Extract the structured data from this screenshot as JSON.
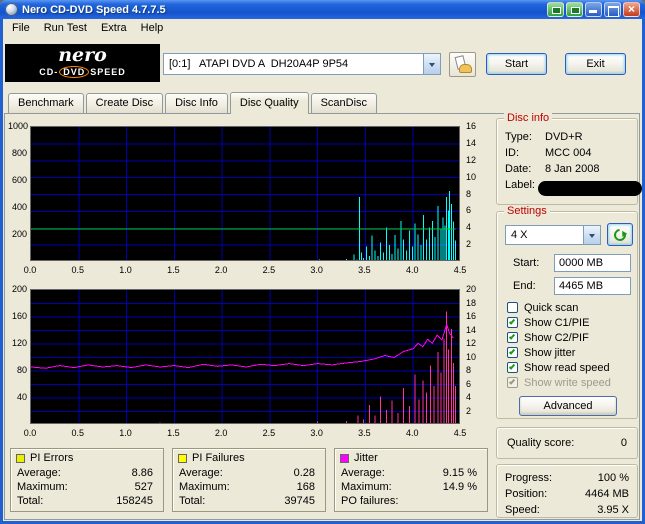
{
  "window": {
    "title": "Nero CD-DVD Speed 4.7.7.5"
  },
  "menu": {
    "items": [
      {
        "label": "File"
      },
      {
        "label": "Run Test"
      },
      {
        "label": "Extra"
      },
      {
        "label": "Help"
      }
    ]
  },
  "logo": {
    "script": "nero",
    "sub_prefix": "CD-",
    "sub_oval": "DVD",
    "sub_suffix": "SPEED"
  },
  "toolbar": {
    "drive": "[0:1]   ATAPI DVD A  DH20A4P 9P54",
    "start_label": "Start",
    "exit_label": "Exit"
  },
  "tabs": {
    "active": "Disc Quality",
    "items": [
      {
        "label": "Benchmark"
      },
      {
        "label": "Create Disc"
      },
      {
        "label": "Disc Info"
      },
      {
        "label": "Disc Quality"
      },
      {
        "label": "ScanDisc"
      }
    ]
  },
  "disc_info": {
    "title": "Disc info",
    "rows": [
      {
        "label": "Type:",
        "value": "DVD+R"
      },
      {
        "label": "ID:",
        "value": "MCC 004"
      },
      {
        "label": "Date:",
        "value": "8 Jan 2008"
      },
      {
        "label": "Label:",
        "value": ""
      }
    ]
  },
  "settings": {
    "title": "Settings",
    "speed_value": "4 X",
    "start": {
      "label": "Start:",
      "value": "0000 MB"
    },
    "end": {
      "label": "End:",
      "value": "4465 MB"
    },
    "checkboxes": [
      {
        "label": "Quick scan",
        "checked": false,
        "disabled": false
      },
      {
        "label": "Show C1/PIE",
        "checked": true,
        "disabled": false
      },
      {
        "label": "Show C2/PIF",
        "checked": true,
        "disabled": false
      },
      {
        "label": "Show jitter",
        "checked": true,
        "disabled": false
      },
      {
        "label": "Show read speed",
        "checked": true,
        "disabled": false
      },
      {
        "label": "Show write speed",
        "checked": true,
        "disabled": true
      }
    ],
    "advanced_label": "Advanced"
  },
  "quality": {
    "label": "Quality score:",
    "value": "0"
  },
  "progress": {
    "rows": [
      {
        "label": "Progress:",
        "value": "100 %"
      },
      {
        "label": "Position:",
        "value": "4464 MB"
      },
      {
        "label": "Speed:",
        "value": "3.95 X"
      }
    ]
  },
  "stats": [
    {
      "title": "PI Errors",
      "color": "#e8f000",
      "rows": [
        {
          "label": "Average:",
          "value": "8.86"
        },
        {
          "label": "Maximum:",
          "value": "527"
        },
        {
          "label": "Total:",
          "value": "158245"
        }
      ]
    },
    {
      "title": "PI Failures",
      "color": "#ffff00",
      "rows": [
        {
          "label": "Average:",
          "value": "0.28"
        },
        {
          "label": "Maximum:",
          "value": "168"
        },
        {
          "label": "Total:",
          "value": "39745"
        }
      ]
    },
    {
      "title": "Jitter",
      "color": "#ff00ff",
      "rows": [
        {
          "label": "Average:",
          "value": "9.15 %"
        },
        {
          "label": "Maximum:",
          "value": "14.9 %"
        },
        {
          "label": "PO failures:",
          "value": ""
        }
      ]
    }
  ],
  "chart_data": [
    {
      "type": "line",
      "title": "PIE errors and read speed vs disc position (GB)",
      "x_min": 0,
      "x_max": 4.5,
      "x_tick_step": 0.5,
      "x_tick_labels": [
        "0.0",
        "0.5",
        "1.0",
        "1.5",
        "2.0",
        "2.5",
        "3.0",
        "3.5",
        "4.0",
        "4.5"
      ],
      "left_axis": {
        "max": 1000,
        "ticks": [
          1000,
          800,
          600,
          400,
          200
        ]
      },
      "right_axis": {
        "max": 16,
        "ticks": [
          16,
          14,
          12,
          10,
          8,
          6,
          4,
          2
        ]
      },
      "bg": "#000000",
      "grid_color": "#0000b0",
      "legend": "off",
      "series": [
        {
          "name": "C1/PIE errors",
          "style": "spikes",
          "axis": "left",
          "color": "#00ffff",
          "points": [
            [
              0.03,
              2
            ],
            [
              0.1,
              3
            ],
            [
              0.18,
              2
            ],
            [
              0.26,
              4
            ],
            [
              0.34,
              2
            ],
            [
              0.42,
              3
            ],
            [
              0.5,
              6
            ],
            [
              0.55,
              14
            ],
            [
              0.62,
              3
            ],
            [
              0.7,
              2
            ],
            [
              0.78,
              4
            ],
            [
              0.86,
              2
            ],
            [
              0.94,
              3
            ],
            [
              1.02,
              10
            ],
            [
              1.1,
              3
            ],
            [
              1.18,
              2
            ],
            [
              1.26,
              4
            ],
            [
              1.34,
              2
            ],
            [
              1.42,
              5
            ],
            [
              1.5,
              3
            ],
            [
              1.58,
              2
            ],
            [
              1.66,
              4
            ],
            [
              1.74,
              2
            ],
            [
              1.82,
              3
            ],
            [
              1.9,
              2
            ],
            [
              1.98,
              5
            ],
            [
              2.06,
              3
            ],
            [
              2.14,
              2
            ],
            [
              2.22,
              4
            ],
            [
              2.3,
              14
            ],
            [
              2.38,
              3
            ],
            [
              2.46,
              2
            ],
            [
              2.54,
              5
            ],
            [
              2.62,
              3
            ],
            [
              2.7,
              2
            ],
            [
              2.78,
              4
            ],
            [
              2.86,
              3
            ],
            [
              2.94,
              2
            ],
            [
              3.02,
              18
            ],
            [
              3.08,
              6
            ],
            [
              3.14,
              4
            ],
            [
              3.2,
              10
            ],
            [
              3.26,
              8
            ],
            [
              3.3,
              24
            ],
            [
              3.34,
              12
            ],
            [
              3.38,
              55
            ],
            [
              3.41,
              20
            ],
            [
              3.44,
              480
            ],
            [
              3.46,
              70
            ],
            [
              3.48,
              30
            ],
            [
              3.51,
              115
            ],
            [
              3.54,
              45
            ],
            [
              3.57,
              195
            ],
            [
              3.6,
              85
            ],
            [
              3.63,
              45
            ],
            [
              3.66,
              145
            ],
            [
              3.69,
              70
            ],
            [
              3.72,
              255
            ],
            [
              3.75,
              125
            ],
            [
              3.78,
              60
            ],
            [
              3.81,
              200
            ],
            [
              3.84,
              100
            ],
            [
              3.87,
              305
            ],
            [
              3.9,
              165
            ],
            [
              3.93,
              85
            ],
            [
              3.96,
              235
            ],
            [
              3.99,
              115
            ],
            [
              4.02,
              285
            ],
            [
              4.05,
              205
            ],
            [
              4.08,
              125
            ],
            [
              4.11,
              350
            ],
            [
              4.14,
              165
            ],
            [
              4.17,
              255
            ],
            [
              4.2,
              305
            ],
            [
              4.23,
              185
            ],
            [
              4.26,
              415
            ],
            [
              4.29,
              240
            ],
            [
              4.31,
              330
            ],
            [
              4.33,
              270
            ],
            [
              4.35,
              480
            ],
            [
              4.37,
              380
            ],
            [
              4.38,
              527
            ],
            [
              4.4,
              430
            ],
            [
              4.42,
              300
            ],
            [
              4.44,
              160
            ]
          ]
        },
        {
          "name": "Read speed (X)",
          "style": "line",
          "axis": "right",
          "color": "#00cc00",
          "points": [
            [
              0,
              3.9
            ],
            [
              4.44,
              3.9
            ]
          ]
        }
      ]
    },
    {
      "type": "line",
      "title": "PIF errors and jitter vs disc position (GB)",
      "x_min": 0,
      "x_max": 4.5,
      "x_tick_step": 0.5,
      "x_tick_labels": [
        "0.0",
        "0.5",
        "1.0",
        "1.5",
        "2.0",
        "2.5",
        "3.0",
        "3.5",
        "4.0",
        "4.5"
      ],
      "left_axis": {
        "max": 200,
        "ticks": [
          200,
          160,
          120,
          80,
          40
        ]
      },
      "right_axis": {
        "max": 20,
        "ticks": [
          20,
          18,
          16,
          14,
          12,
          10,
          8,
          6,
          4,
          2
        ]
      },
      "bg": "#000000",
      "grid_color": "#0000b0",
      "legend": "off",
      "series": [
        {
          "name": "C2/PIF errors",
          "style": "spikes",
          "axis": "left",
          "color": "#ff3399",
          "points": [
            [
              0.45,
              2
            ],
            [
              0.9,
              3
            ],
            [
              1.35,
              4
            ],
            [
              1.8,
              2
            ],
            [
              2.25,
              3
            ],
            [
              2.7,
              2
            ],
            [
              3.0,
              5
            ],
            [
              3.15,
              3
            ],
            [
              3.3,
              6
            ],
            [
              3.42,
              14
            ],
            [
              3.48,
              8
            ],
            [
              3.54,
              30
            ],
            [
              3.6,
              14
            ],
            [
              3.66,
              42
            ],
            [
              3.72,
              22
            ],
            [
              3.78,
              36
            ],
            [
              3.84,
              18
            ],
            [
              3.9,
              55
            ],
            [
              3.96,
              28
            ],
            [
              4.02,
              75
            ],
            [
              4.06,
              38
            ],
            [
              4.1,
              66
            ],
            [
              4.14,
              48
            ],
            [
              4.18,
              88
            ],
            [
              4.22,
              58
            ],
            [
              4.26,
              108
            ],
            [
              4.29,
              78
            ],
            [
              4.32,
              128
            ],
            [
              4.35,
              168
            ],
            [
              4.37,
              112
            ],
            [
              4.4,
              142
            ],
            [
              4.42,
              92
            ],
            [
              4.44,
              58
            ]
          ]
        },
        {
          "name": "Jitter (%)",
          "style": "line",
          "axis": "right",
          "color": "#ff00ff",
          "points": [
            [
              0,
              8.6
            ],
            [
              0.15,
              8.4
            ],
            [
              0.3,
              8.8
            ],
            [
              0.45,
              8.5
            ],
            [
              0.6,
              8.9
            ],
            [
              0.75,
              8.6
            ],
            [
              0.9,
              8.8
            ],
            [
              1.05,
              8.5
            ],
            [
              1.2,
              8.9
            ],
            [
              1.35,
              8.6
            ],
            [
              1.5,
              8.8
            ],
            [
              1.65,
              8.5
            ],
            [
              1.8,
              9.0
            ],
            [
              1.95,
              8.7
            ],
            [
              2.1,
              8.9
            ],
            [
              2.25,
              8.6
            ],
            [
              2.4,
              9.0
            ],
            [
              2.55,
              8.8
            ],
            [
              2.7,
              9.1
            ],
            [
              2.85,
              8.8
            ],
            [
              3.0,
              9.1
            ],
            [
              3.15,
              8.9
            ],
            [
              3.3,
              9.2
            ],
            [
              3.45,
              9.4
            ],
            [
              3.6,
              9.8
            ],
            [
              3.7,
              10.3
            ],
            [
              3.8,
              10.0
            ],
            [
              3.9,
              10.9
            ],
            [
              4.0,
              11.3
            ],
            [
              4.05,
              12.1
            ],
            [
              4.1,
              11.6
            ],
            [
              4.15,
              12.7
            ],
            [
              4.2,
              12.1
            ],
            [
              4.25,
              13.3
            ],
            [
              4.3,
              12.6
            ],
            [
              4.35,
              14.9
            ],
            [
              4.38,
              13.6
            ],
            [
              4.42,
              12.9
            ]
          ]
        }
      ]
    }
  ]
}
